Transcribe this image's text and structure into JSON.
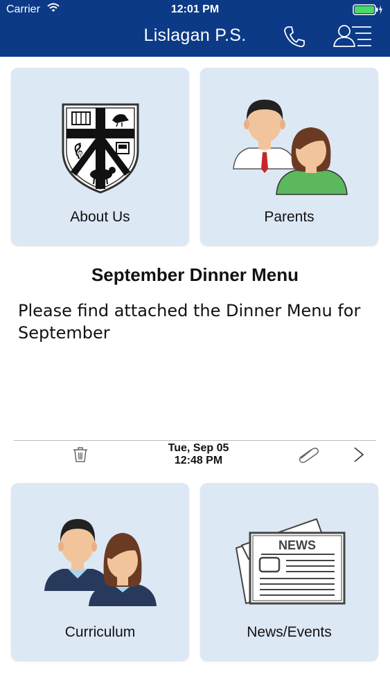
{
  "status_bar": {
    "carrier": "Carrier",
    "time": "12:01 PM",
    "battery_color": "#4cd964"
  },
  "nav": {
    "title": "Lislagan P.S.",
    "background": "#0c3a86",
    "icons": [
      "phone-icon",
      "contacts-icon"
    ]
  },
  "tiles": [
    {
      "label": "About Us",
      "icon": "school-crest-icon"
    },
    {
      "label": "Parents",
      "icon": "parents-icon"
    },
    {
      "label": "Curriculum",
      "icon": "students-icon"
    },
    {
      "label": "News/Events",
      "icon": "newspaper-icon"
    }
  ],
  "message": {
    "title": "September Dinner Menu",
    "body": "Please find attached the Dinner Menu for September",
    "date": "Tue, Sep 05",
    "time": "12:48 PM",
    "icons": [
      "trash-icon",
      "attachment-icon",
      "chevron-right-icon"
    ]
  },
  "colors": {
    "tile_background": "#dde8f5"
  }
}
